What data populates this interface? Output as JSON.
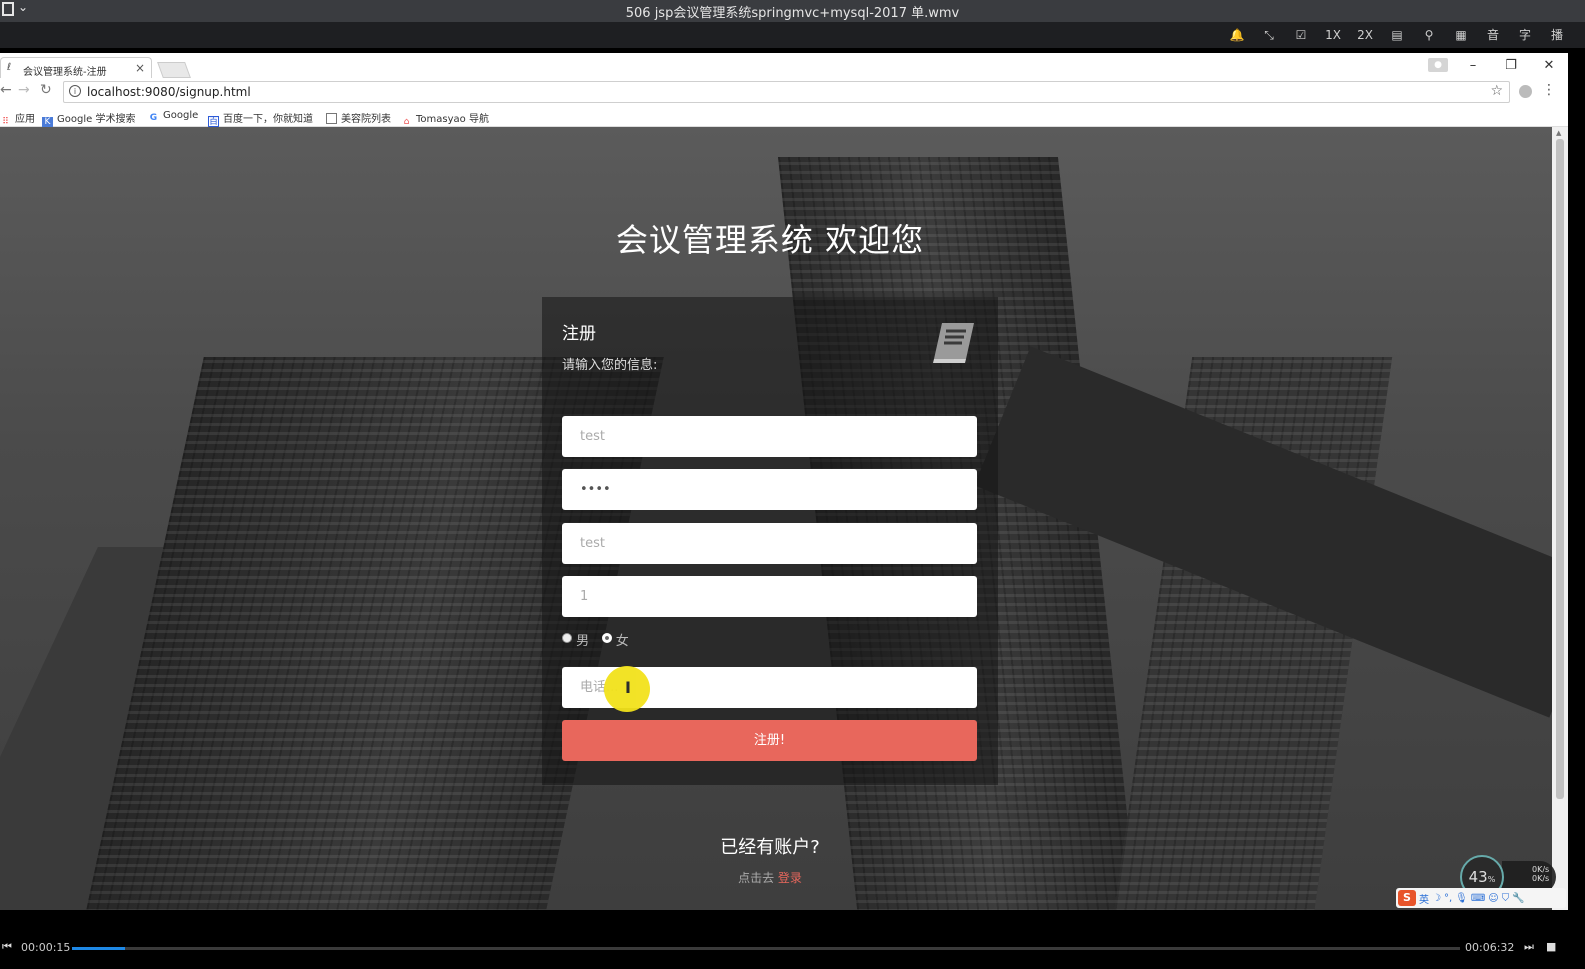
{
  "player": {
    "title": "506 jsp会议管理系统springmvc+mysql-2017 单.wmv",
    "toolbar": [
      "🔔",
      "⤡",
      "☑",
      "1X",
      "2X",
      "▤",
      "⚲",
      "▦",
      "音",
      "字",
      "播"
    ],
    "current_time": "00:00:15",
    "total_time": "00:06:32",
    "progress_fraction": 0.038
  },
  "browser": {
    "tab_title": "会议管理系统-注册",
    "url": "localhost:9080/signup.html",
    "bookmarks": [
      "应用",
      "Google 学术搜索",
      "Google",
      "百度一下，你就知道",
      "美容院列表",
      "Tomasyao 导航"
    ]
  },
  "page": {
    "welcome": "会议管理系统 欢迎您",
    "card_title": "注册",
    "card_hint": "请输入您的信息:",
    "fields": {
      "username": "test",
      "password": "••••",
      "name": "test",
      "age": "1",
      "phone_placeholder": "电话..."
    },
    "gender": {
      "male": "男",
      "female": "女",
      "selected": "女"
    },
    "submit_label": "注册!",
    "already": "已经有账户?",
    "goto_prefix": "点击去",
    "login_link": "登录"
  },
  "overlay": {
    "net_percent": "43",
    "net_percent_unit": "%",
    "net_up": "0K/s",
    "net_down": "0K/s",
    "ime_lang": "英"
  },
  "colors": {
    "accent": "#e8675c",
    "progress": "#1e88e5"
  }
}
